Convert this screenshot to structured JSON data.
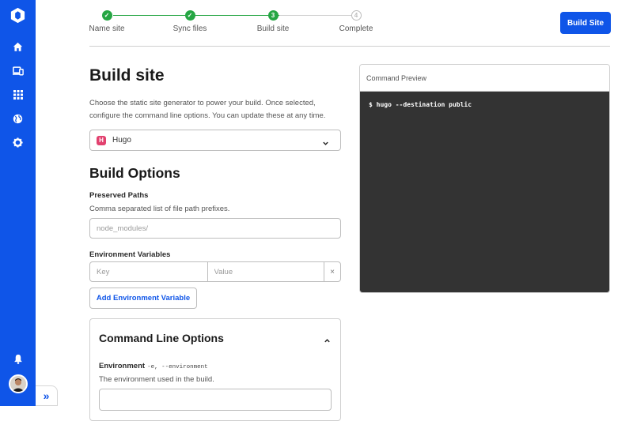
{
  "sidebar": {
    "icons": [
      "logo-icon",
      "home-icon",
      "sites-icon",
      "apps-icon",
      "globe-icon",
      "gear-icon",
      "bell-icon",
      "avatar"
    ],
    "expand_label": "»"
  },
  "stepper": {
    "steps": [
      {
        "label": "Name site",
        "state": "done",
        "marker": "✓"
      },
      {
        "label": "Sync files",
        "state": "done",
        "marker": "✓"
      },
      {
        "label": "Build site",
        "state": "current",
        "marker": "3"
      },
      {
        "label": "Complete",
        "state": "todo",
        "marker": "4"
      }
    ]
  },
  "header": {
    "build_button": "Build Site"
  },
  "main": {
    "title": "Build site",
    "description": "Choose the static site generator to power your build. Once selected, configure the command line options. You can update these at any time.",
    "generator": {
      "logo_letter": "H",
      "selected": "Hugo"
    },
    "options_title": "Build Options",
    "preserved_paths": {
      "label": "Preserved Paths",
      "hint": "Comma separated list of file path prefixes.",
      "placeholder": "node_modules/"
    },
    "env_vars": {
      "label": "Environment Variables",
      "key_placeholder": "Key",
      "value_placeholder": "Value",
      "remove_label": "×",
      "add_button": "Add Environment Variable"
    },
    "command_line": {
      "title": "Command Line Options",
      "environment_label": "Environment",
      "environment_flags": "-e, --environment",
      "environment_hint": "The environment used in the build."
    }
  },
  "preview": {
    "title": "Command Preview",
    "command": "$ hugo --destination public"
  },
  "colors": {
    "accent": "#0f55e8",
    "success": "#26a644",
    "terminal": "#333333"
  }
}
